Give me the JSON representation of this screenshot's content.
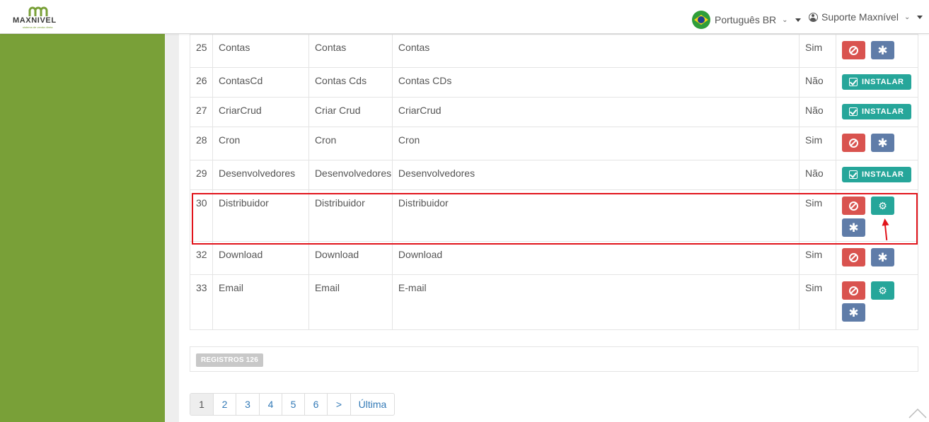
{
  "header": {
    "logo_text": "MAXNIVEL",
    "logo_tagline": "sistema de venda direta",
    "language": "Português BR",
    "user": "Suporte Maxnível"
  },
  "modules": [
    {
      "num": "25",
      "name": "Contas",
      "label": "Contas",
      "desc": "Contas",
      "installed": "Sim",
      "actions": [
        "disable",
        "star"
      ]
    },
    {
      "num": "26",
      "name": "ContasCd",
      "label": "Contas Cds",
      "desc": "Contas CDs",
      "installed": "Não",
      "actions": [
        "install"
      ]
    },
    {
      "num": "27",
      "name": "CriarCrud",
      "label": "Criar Crud",
      "desc": "CriarCrud",
      "installed": "Não",
      "actions": [
        "install"
      ]
    },
    {
      "num": "28",
      "name": "Cron",
      "label": "Cron",
      "desc": "Cron",
      "installed": "Sim",
      "actions": [
        "disable",
        "star"
      ]
    },
    {
      "num": "29",
      "name": "Desenvolvedores",
      "label": "Desenvolvedores",
      "desc": "Desenvolvedores",
      "installed": "Não",
      "actions": [
        "install"
      ]
    },
    {
      "num": "30",
      "name": "Distribuidor",
      "label": "Distribuidor",
      "desc": "Distribuidor",
      "installed": "Sim",
      "actions": [
        "disable",
        "config",
        "star"
      ]
    },
    {
      "num": "32",
      "name": "Download",
      "label": "Download",
      "desc": "Download",
      "installed": "Sim",
      "actions": [
        "disable",
        "star"
      ]
    },
    {
      "num": "33",
      "name": "Email",
      "label": "Email",
      "desc": "E-mail",
      "installed": "Sim",
      "actions": [
        "disable",
        "config",
        "star"
      ]
    }
  ],
  "install_label": "INSTALAR",
  "records_label": "REGISTROS 126",
  "pagination": [
    "1",
    "2",
    "3",
    "4",
    "5",
    "6",
    ">",
    "Última"
  ],
  "colors": {
    "sidebar": "#79a038",
    "danger": "#d9534f",
    "primary": "#5f7ca8",
    "teal": "#26a69a",
    "highlight": "#e1141b"
  }
}
